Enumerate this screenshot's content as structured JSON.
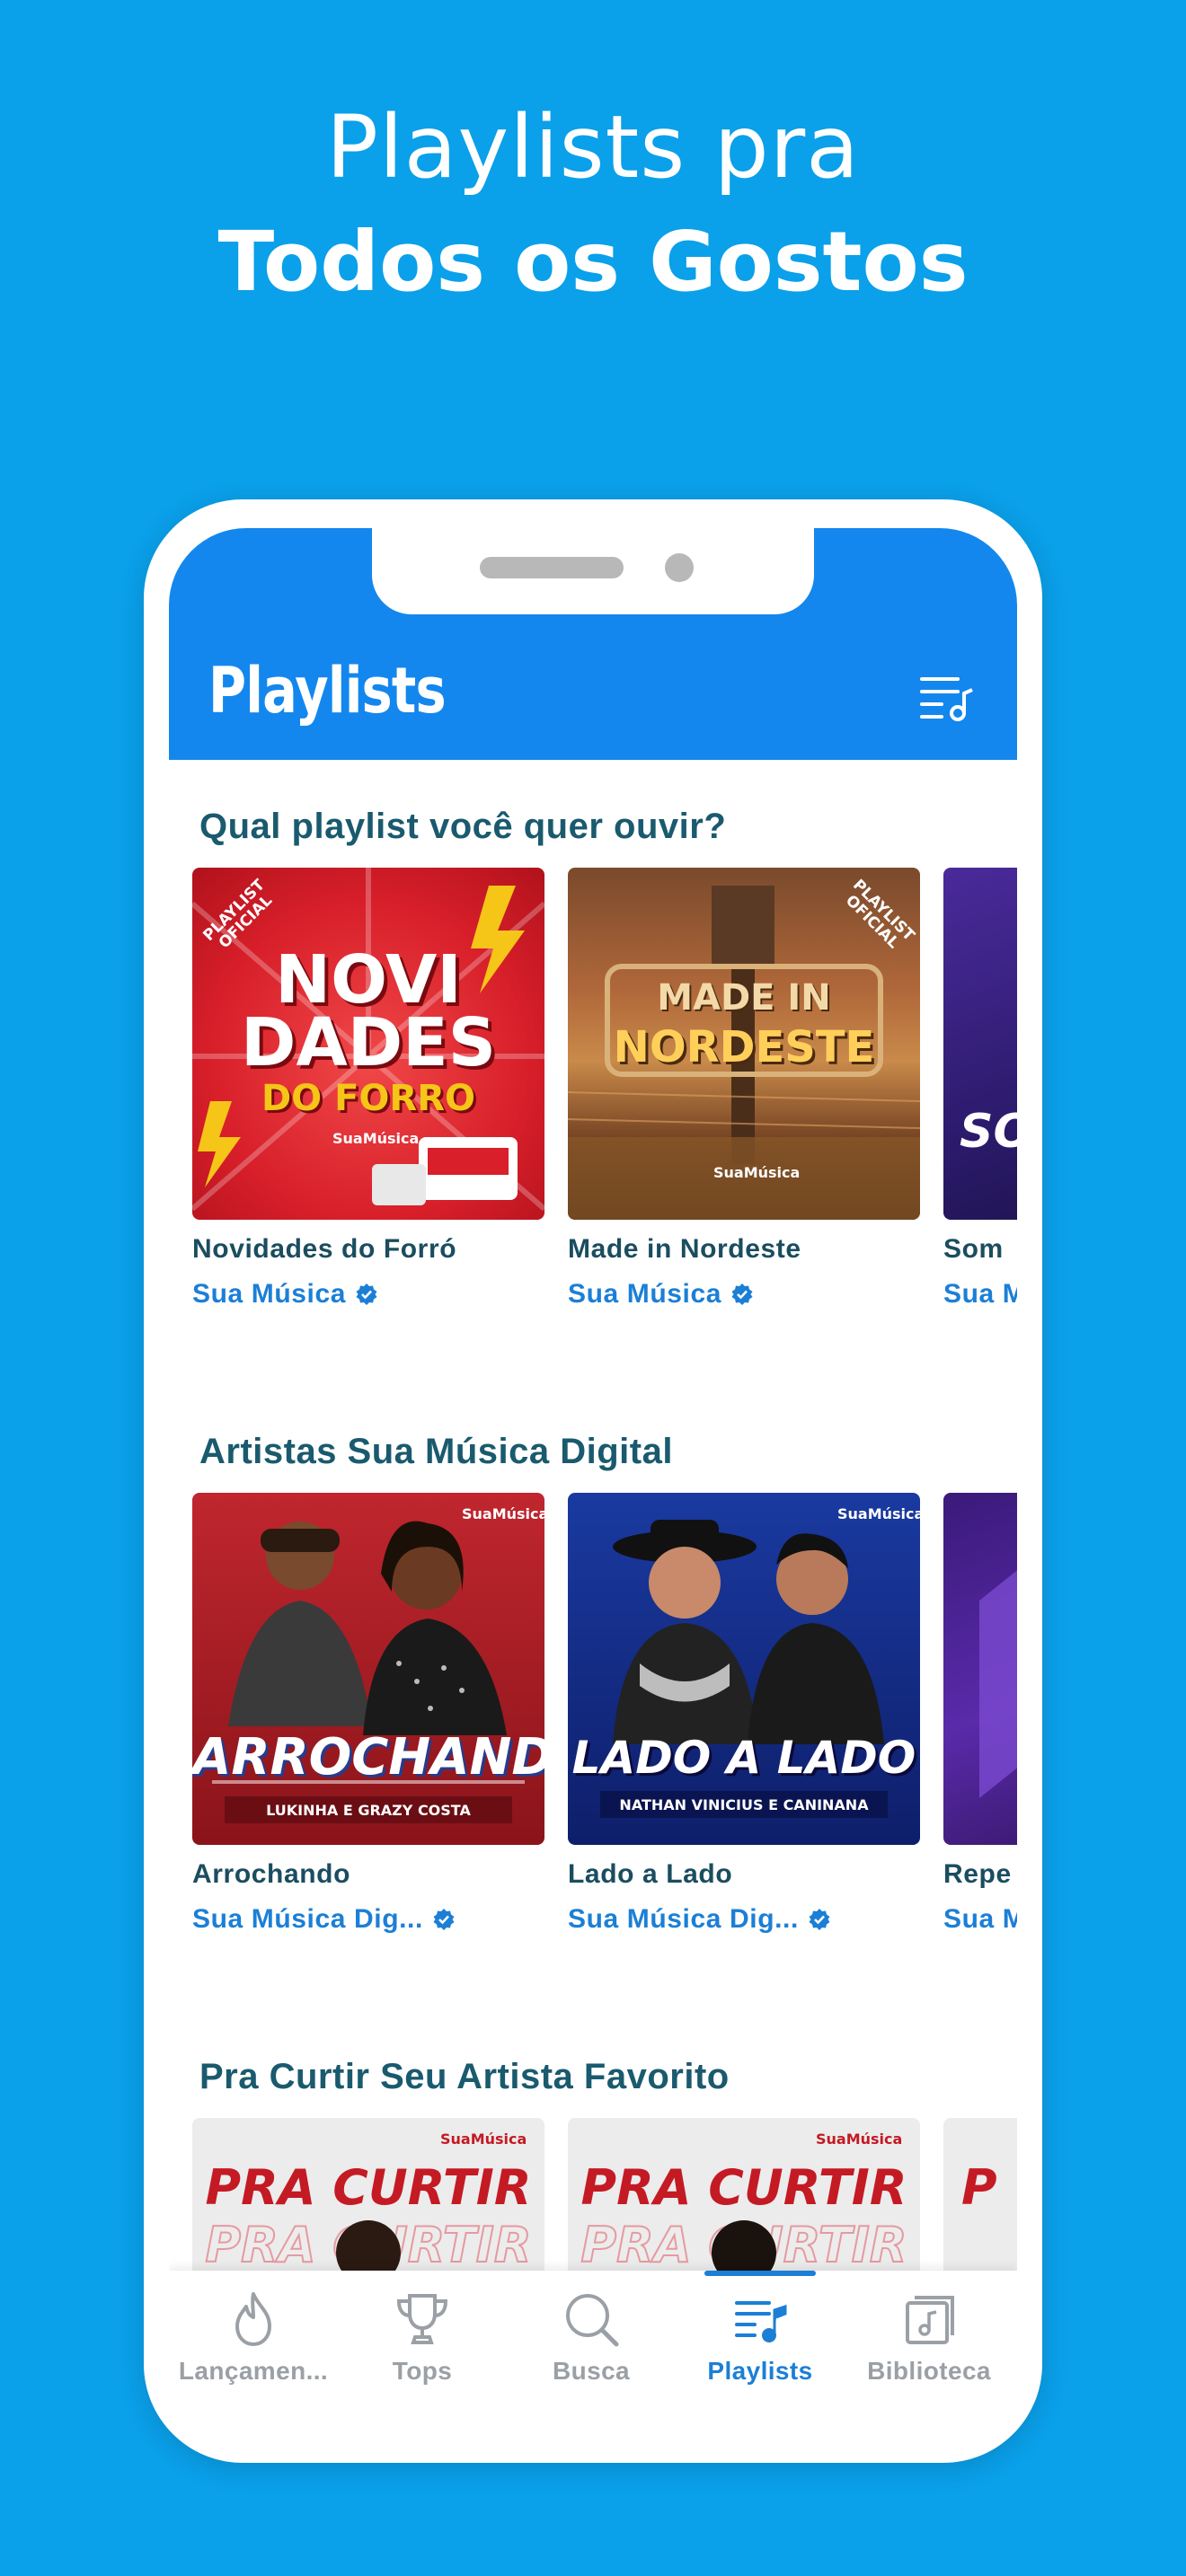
{
  "promo": {
    "line1": "Playlists pra",
    "line2": "Todos os Gostos"
  },
  "app_bar": {
    "title": "Playlists",
    "queue_icon": "playlist-music-icon"
  },
  "sections": [
    {
      "title": "Qual playlist você quer ouvir?",
      "cards": [
        {
          "title": "Novidades do Forró",
          "subtitle": "Sua Música",
          "cover_text": [
            "NOVI",
            "DADES",
            "DO FORRO"
          ],
          "badge": "PLAYLIST OFICIAL",
          "brand": "SuaMúsica"
        },
        {
          "title": "Made in Nordeste",
          "subtitle": "Sua Música",
          "cover_text": [
            "MADE IN",
            "NORDESTE"
          ],
          "badge": "PLAYLIST OFICIAL",
          "brand": "SuaMúsica"
        },
        {
          "title": "Som",
          "subtitle": "Sua M",
          "cover_text": [
            "SOI"
          ]
        }
      ]
    },
    {
      "title": "Artistas Sua Música Digital",
      "cards": [
        {
          "title": "Arrochando",
          "subtitle": "Sua Música Dig...",
          "cover_text": [
            "ARROCHANDO",
            "LUKINHA E GRAZY COSTA"
          ],
          "brand": "SuaMúsica"
        },
        {
          "title": "Lado a Lado",
          "subtitle": "Sua Música Dig...",
          "cover_text": [
            "LADO A LADO",
            "NATHAN VINICIUS E CANINANA"
          ],
          "brand": "SuaMúsica"
        },
        {
          "title": "Repe",
          "subtitle": "Sua M"
        }
      ]
    },
    {
      "title": "Pra Curtir Seu Artista Favorito",
      "cards": [
        {
          "cover_text": [
            "PRA",
            "CURTIR"
          ],
          "brand": "SuaMúsica"
        },
        {
          "cover_text": [
            "PRA",
            "CURTIR"
          ],
          "brand": "SuaMúsica"
        },
        {
          "cover_text": [
            "P"
          ]
        }
      ]
    }
  ],
  "tabs": [
    {
      "label": "Lançamen...",
      "icon": "flame-icon",
      "active": false
    },
    {
      "label": "Tops",
      "icon": "trophy-icon",
      "active": false
    },
    {
      "label": "Busca",
      "icon": "search-icon",
      "active": false
    },
    {
      "label": "Playlists",
      "icon": "playlist-icon",
      "active": true
    },
    {
      "label": "Biblioteca",
      "icon": "library-icon",
      "active": false
    }
  ],
  "colors": {
    "background": "#0aa0ea",
    "app_bar": "#1387ee",
    "accent": "#1c7fd6",
    "heading": "#1a5a6e"
  }
}
